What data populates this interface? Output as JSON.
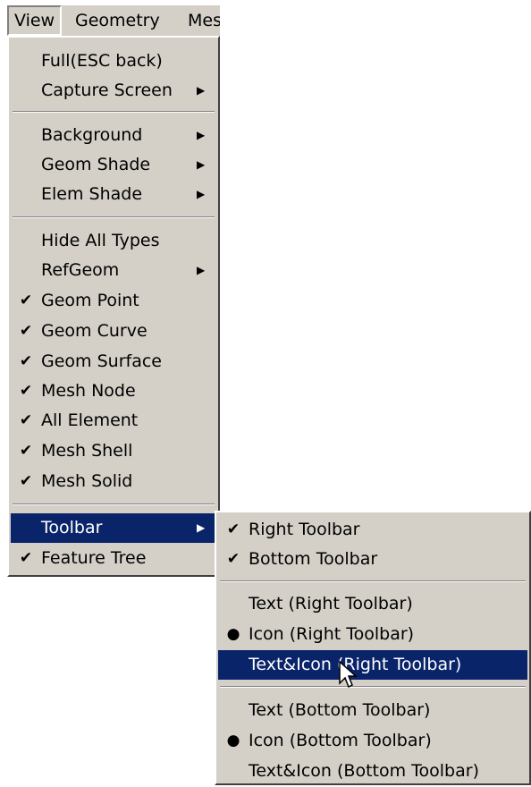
{
  "menubar": {
    "items": [
      {
        "label": "View"
      },
      {
        "label": "Geometry"
      },
      {
        "label": "Mes"
      }
    ]
  },
  "view_menu": {
    "items": [
      {
        "label": "Full(ESC back)",
        "mark": "",
        "submenu": false
      },
      {
        "label": "Capture Screen",
        "mark": "",
        "submenu": true
      },
      {
        "label": "Background",
        "mark": "",
        "submenu": true
      },
      {
        "label": "Geom Shade",
        "mark": "",
        "submenu": true
      },
      {
        "label": "Elem Shade",
        "mark": "",
        "submenu": true
      },
      {
        "label": "Hide All Types",
        "mark": "",
        "submenu": false
      },
      {
        "label": "RefGeom",
        "mark": "",
        "submenu": true
      },
      {
        "label": "Geom Point",
        "mark": "✔",
        "submenu": false
      },
      {
        "label": "Geom Curve",
        "mark": "✔",
        "submenu": false
      },
      {
        "label": "Geom Surface",
        "mark": "✔",
        "submenu": false
      },
      {
        "label": "Mesh Node",
        "mark": "✔",
        "submenu": false
      },
      {
        "label": "All Element",
        "mark": "✔",
        "submenu": false
      },
      {
        "label": "Mesh Shell",
        "mark": "✔",
        "submenu": false
      },
      {
        "label": "Mesh Solid",
        "mark": "✔",
        "submenu": false
      },
      {
        "label": "Toolbar",
        "mark": "",
        "submenu": true,
        "selected": true
      },
      {
        "label": "Feature Tree",
        "mark": "✔",
        "submenu": false
      }
    ]
  },
  "toolbar_menu": {
    "items": [
      {
        "label": "Right Toolbar",
        "mark": "✔"
      },
      {
        "label": "Bottom Toolbar",
        "mark": "✔"
      },
      {
        "label": "Text (Right Toolbar)",
        "mark": ""
      },
      {
        "label": "Icon (Right Toolbar)",
        "mark": "●"
      },
      {
        "label": "Text&Icon (Right Toolbar)",
        "mark": "",
        "selected": true
      },
      {
        "label": "Text (Bottom Toolbar)",
        "mark": ""
      },
      {
        "label": "Icon (Bottom Toolbar)",
        "mark": "●"
      },
      {
        "label": "Text&Icon (Bottom Toolbar)",
        "mark": ""
      }
    ]
  },
  "colors": {
    "menu_bg": "#d4d0c8",
    "selection_bg": "#0a246a",
    "selection_text": "#ffffff"
  },
  "icons": {
    "check": "checkmark-icon",
    "radio": "bullet-icon",
    "submenu": "submenu-arrow-icon",
    "cursor": "mouse-cursor-icon"
  }
}
